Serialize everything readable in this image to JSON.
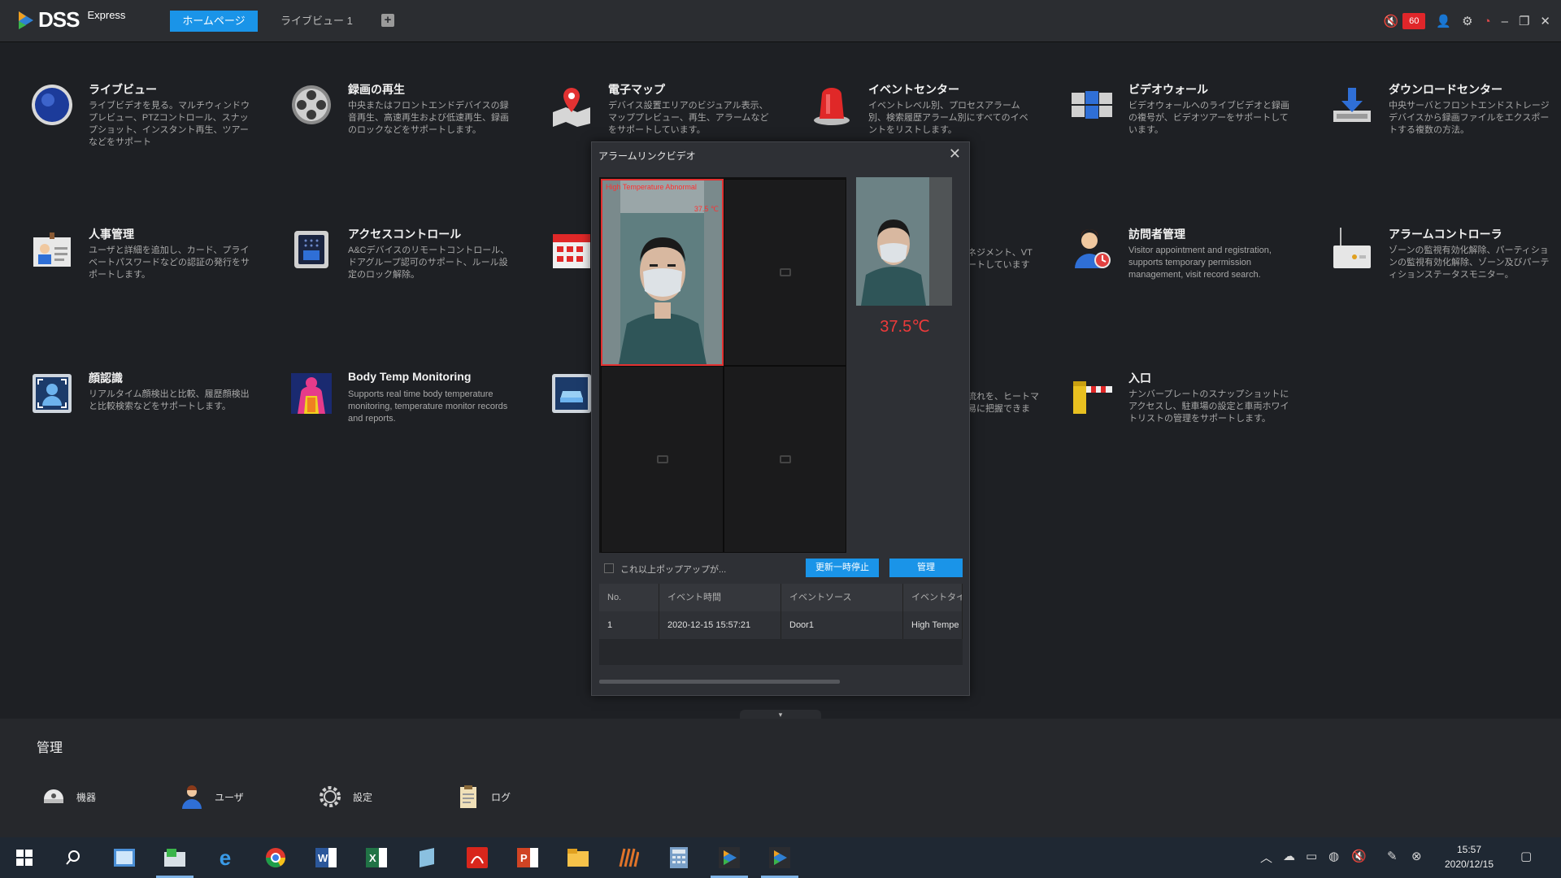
{
  "app": {
    "logo_text": "DSS",
    "logo_sub": "Express",
    "tabs": [
      {
        "label": "ホームページ"
      },
      {
        "label": "ライブビュー 1"
      }
    ],
    "add_tab": "+",
    "alarm_count": "60"
  },
  "apps": [
    {
      "title": "ライブビュー",
      "desc": "ライブビデオを見る。マルチウィンドウプレビュー、PTZコントロール、スナップショット、インスタント再生、ツアーなどをサポート"
    },
    {
      "title": "録画の再生",
      "desc": "中央またはフロントエンドデバイスの録音再生、高速再生および低速再生、録画のロックなどをサポートします。"
    },
    {
      "title": "電子マップ",
      "desc": "デバイス設置エリアのビジュアル表示、マッププレビュー、再生、アラームなどをサポートしています。"
    },
    {
      "title": "イベントセンター",
      "desc": "イベントレベル別、プロセスアラーム別、検索履歴アラーム別にすべてのイベントをリストします。"
    },
    {
      "title": "ビデオウォール",
      "desc": "ビデオウォールへのライブビデオと録画の複号が、ビデオツアーをサポートしています。"
    },
    {
      "title": "ダウンロードセンター",
      "desc": "中央サーバとフロントエンドストレージデバイスから録画ファイルをエクスポートする複数の方法。"
    },
    {
      "title": "人事管理",
      "desc": "ユーザと詳細を追加し、カード、プライベートパスワードなどの認証の発行をサポートします。"
    },
    {
      "title": "アクセスコントロール",
      "desc": "A&Cデバイスのリモートコントロール、ドアグループ認可のサポート、ルール設定のロック解除。"
    },
    {
      "title": "",
      "desc": ""
    },
    {
      "title": "",
      "desc": "ネジメント、VT ートしています"
    },
    {
      "title": "訪問者管理",
      "desc": "Visitor appointment and registration, supports temporary permission management, visit record search."
    },
    {
      "title": "アラームコントローラ",
      "desc": "ゾーンの監視有効化解除、パーティションの監視有効化解除、ゾーン及びパーティションステータスモニター。"
    },
    {
      "title": "顔認識",
      "desc": "リアルタイム顔検出と比較、履歴顔検出と比較検索などをサポートします。"
    },
    {
      "title": "Body Temp Monitoring",
      "desc": "Supports real time body temperature monitoring, temperature monitor records and reports."
    },
    {
      "title": "",
      "desc": ""
    },
    {
      "title": "",
      "desc": "流れを、ヒートマ 易に把握できま"
    },
    {
      "title": "入口",
      "desc": "ナンバープレートのスナップショットにアクセスし、駐車場の設定と車両ホワイトリストの管理をサポートします。"
    }
  ],
  "popup": {
    "title": "アラームリンクビデオ",
    "overlay_text": "High Temperature Abnormal",
    "overlay_temp": "37.5 ℃",
    "temperature": "37.5℃",
    "checkbox_label": "これ以上ポップアップが...",
    "pause_button": "更新一時停止",
    "manage_button": "管理",
    "columns": [
      "No.",
      "イベント時間",
      "イベントソース",
      "イベントタイプ"
    ],
    "rows": [
      [
        "1",
        "2020-12-15 15:57:21",
        "Door1",
        "High Tempe"
      ]
    ]
  },
  "management": {
    "title": "管理",
    "items": [
      {
        "label": "機器"
      },
      {
        "label": "ユーザ"
      },
      {
        "label": "設定"
      },
      {
        "label": "ログ"
      }
    ]
  },
  "taskbar": {
    "time": "15:57",
    "date": "2020/12/15"
  },
  "colors": {
    "accent": "#1a94e8",
    "alarm": "#e0262a",
    "temperature": "#ee3a3a"
  }
}
